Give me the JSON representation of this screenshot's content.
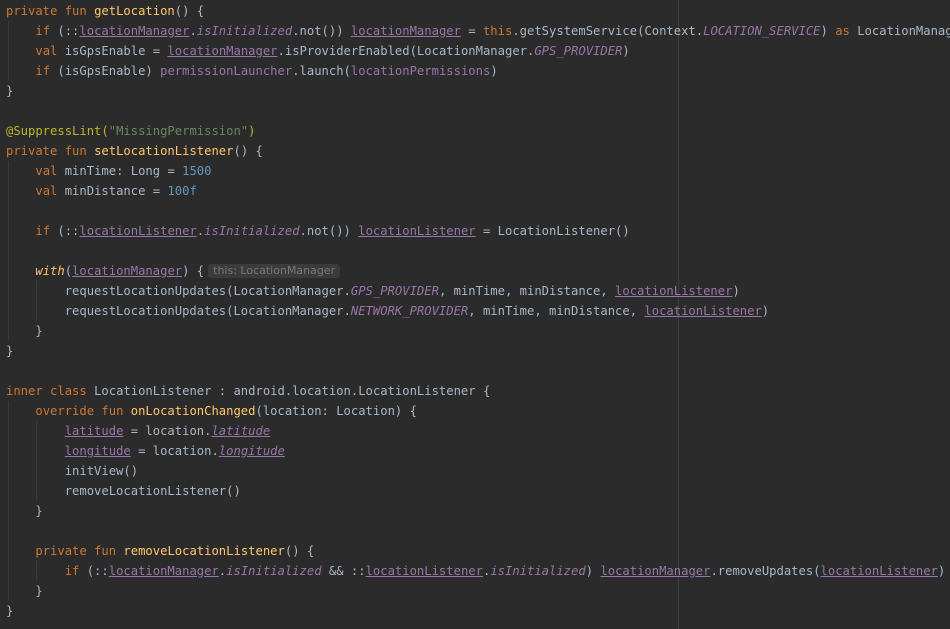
{
  "editor": {
    "lines": [
      {
        "tokens": [
          {
            "t": "private fun ",
            "c": "kw"
          },
          {
            "t": "getLocation",
            "c": "fn"
          },
          {
            "t": "() {",
            "c": "plain"
          }
        ]
      },
      {
        "tokens": [
          {
            "t": "    "
          },
          {
            "t": "if ",
            "c": "kw"
          },
          {
            "t": "(::"
          },
          {
            "t": "locationManager",
            "c": "prop ul"
          },
          {
            "t": "."
          },
          {
            "t": "isInitialized",
            "c": "prop it"
          },
          {
            "t": ".not()) "
          },
          {
            "t": "locationManager",
            "c": "prop ul"
          },
          {
            "t": " = "
          },
          {
            "t": "this",
            "c": "kw"
          },
          {
            "t": ".getSystemService(Context."
          },
          {
            "t": "LOCATION_SERVICE",
            "c": "prop it"
          },
          {
            "t": ") "
          },
          {
            "t": "as ",
            "c": "kw"
          },
          {
            "t": "LocationManager"
          }
        ]
      },
      {
        "tokens": [
          {
            "t": "    "
          },
          {
            "t": "val ",
            "c": "kw"
          },
          {
            "t": "isGpsEnable = "
          },
          {
            "t": "locationManager",
            "c": "prop ul"
          },
          {
            "t": ".isProviderEnabled(LocationManager."
          },
          {
            "t": "GPS_PROVIDER",
            "c": "prop it"
          },
          {
            "t": ")"
          }
        ]
      },
      {
        "tokens": [
          {
            "t": "    "
          },
          {
            "t": "if ",
            "c": "kw"
          },
          {
            "t": "(isGpsEnable) "
          },
          {
            "t": "permissionLauncher",
            "c": "prop"
          },
          {
            "t": ".launch("
          },
          {
            "t": "locationPermissions",
            "c": "prop"
          },
          {
            "t": ")"
          }
        ]
      },
      {
        "tokens": [
          {
            "t": "}"
          }
        ]
      },
      {
        "tokens": []
      },
      {
        "tokens": [
          {
            "t": "@SuppressLint(",
            "c": "ann"
          },
          {
            "t": "\"MissingPermission\"",
            "c": "str"
          },
          {
            "t": ")",
            "c": "ann"
          }
        ]
      },
      {
        "tokens": [
          {
            "t": "private fun ",
            "c": "kw"
          },
          {
            "t": "setLocationListener",
            "c": "fn"
          },
          {
            "t": "() {"
          }
        ]
      },
      {
        "tokens": [
          {
            "t": "    "
          },
          {
            "t": "val ",
            "c": "kw"
          },
          {
            "t": "minTime: Long = "
          },
          {
            "t": "1500",
            "c": "num"
          }
        ]
      },
      {
        "tokens": [
          {
            "t": "    "
          },
          {
            "t": "val ",
            "c": "kw"
          },
          {
            "t": "minDistance = "
          },
          {
            "t": "100f",
            "c": "num"
          }
        ]
      },
      {
        "tokens": []
      },
      {
        "tokens": [
          {
            "t": "    "
          },
          {
            "t": "if ",
            "c": "kw"
          },
          {
            "t": "(::"
          },
          {
            "t": "locationListener",
            "c": "prop ul"
          },
          {
            "t": "."
          },
          {
            "t": "isInitialized",
            "c": "prop it"
          },
          {
            "t": ".not()) "
          },
          {
            "t": "locationListener",
            "c": "prop ul"
          },
          {
            "t": " = LocationListener()"
          }
        ]
      },
      {
        "tokens": []
      },
      {
        "tokens": [
          {
            "t": "    "
          },
          {
            "t": "with",
            "c": "fn it"
          },
          {
            "t": "("
          },
          {
            "t": "locationManager",
            "c": "prop ul"
          },
          {
            "t": ") {"
          },
          {
            "t": "this: LocationManager",
            "c": "hint"
          }
        ]
      },
      {
        "tokens": [
          {
            "t": "        requestLocationUpdates(LocationManager."
          },
          {
            "t": "GPS_PROVIDER",
            "c": "prop it"
          },
          {
            "t": ", minTime, minDistance, "
          },
          {
            "t": "locationListener",
            "c": "prop ul"
          },
          {
            "t": ")"
          }
        ]
      },
      {
        "tokens": [
          {
            "t": "        requestLocationUpdates(LocationManager."
          },
          {
            "t": "NETWORK_PROVIDER",
            "c": "prop it"
          },
          {
            "t": ", minTime, minDistance, "
          },
          {
            "t": "locationListener",
            "c": "prop ul"
          },
          {
            "t": ")"
          }
        ]
      },
      {
        "tokens": [
          {
            "t": "    }"
          }
        ]
      },
      {
        "tokens": [
          {
            "t": "}"
          }
        ]
      },
      {
        "tokens": []
      },
      {
        "tokens": [
          {
            "t": "inner class ",
            "c": "kw"
          },
          {
            "t": "LocationListener : android.location.LocationListener {"
          }
        ]
      },
      {
        "tokens": [
          {
            "t": "    "
          },
          {
            "t": "override fun ",
            "c": "kw"
          },
          {
            "t": "onLocationChanged",
            "c": "fn"
          },
          {
            "t": "(location: Location) {"
          }
        ]
      },
      {
        "tokens": [
          {
            "t": "        "
          },
          {
            "t": "latitude",
            "c": "prop ul"
          },
          {
            "t": " = location."
          },
          {
            "t": "latitude",
            "c": "prop it ul"
          }
        ]
      },
      {
        "tokens": [
          {
            "t": "        "
          },
          {
            "t": "longitude",
            "c": "prop ul"
          },
          {
            "t": " = location."
          },
          {
            "t": "longitude",
            "c": "prop it ul"
          }
        ]
      },
      {
        "tokens": [
          {
            "t": "        initView()"
          }
        ]
      },
      {
        "tokens": [
          {
            "t": "        removeLocationListener()"
          }
        ]
      },
      {
        "tokens": [
          {
            "t": "    }"
          }
        ]
      },
      {
        "tokens": []
      },
      {
        "tokens": [
          {
            "t": "    "
          },
          {
            "t": "private fun ",
            "c": "kw"
          },
          {
            "t": "removeLocationListener",
            "c": "fn"
          },
          {
            "t": "() {"
          }
        ]
      },
      {
        "tokens": [
          {
            "t": "        "
          },
          {
            "t": "if ",
            "c": "kw"
          },
          {
            "t": "(::"
          },
          {
            "t": "locationManager",
            "c": "prop ul"
          },
          {
            "t": "."
          },
          {
            "t": "isInitialized",
            "c": "prop it"
          },
          {
            "t": " && ::"
          },
          {
            "t": "locationListener",
            "c": "prop ul"
          },
          {
            "t": "."
          },
          {
            "t": "isInitialized",
            "c": "prop it"
          },
          {
            "t": ") "
          },
          {
            "t": "locationManager",
            "c": "prop ul"
          },
          {
            "t": ".removeUpdates("
          },
          {
            "t": "locationListener",
            "c": "prop ul"
          },
          {
            "t": ")"
          }
        ]
      },
      {
        "tokens": [
          {
            "t": "    }"
          }
        ]
      },
      {
        "tokens": [
          {
            "t": "}"
          }
        ]
      }
    ]
  }
}
